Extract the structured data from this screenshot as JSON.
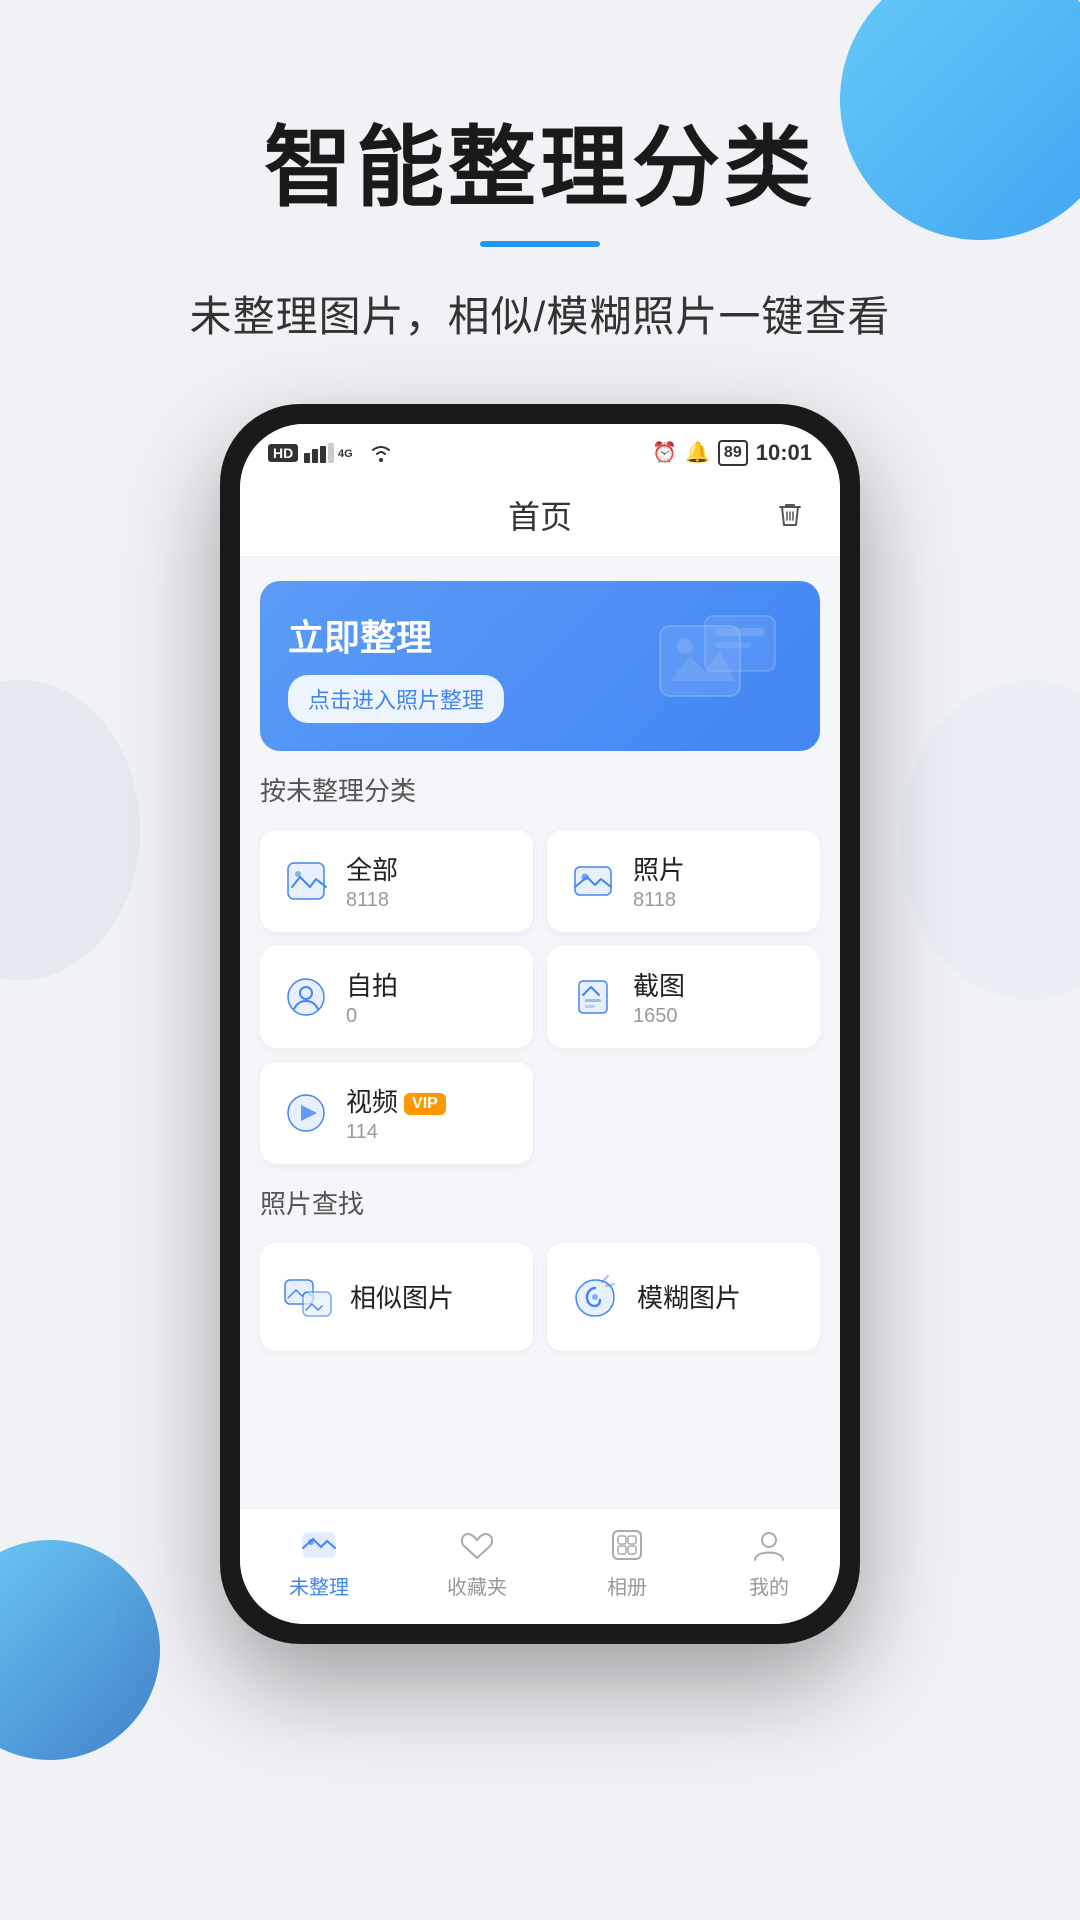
{
  "page": {
    "bg_color": "#f0f2f5",
    "main_title": "智能整理分类",
    "sub_title": "未整理图片，相似/模糊照片一键查看"
  },
  "status_bar": {
    "left": "HD 4G 4G WiFi",
    "alarm": "⏰",
    "battery": "89",
    "time": "10:01"
  },
  "app_header": {
    "title": "首页",
    "trash_label": "trash"
  },
  "banner": {
    "title": "立即整理",
    "button": "点击进入照片整理"
  },
  "section1_label": "按未整理分类",
  "categories": [
    {
      "name": "全部",
      "count": "8118",
      "icon": "all"
    },
    {
      "name": "照片",
      "count": "8118",
      "icon": "photo"
    },
    {
      "name": "自拍",
      "count": "0",
      "icon": "selfie"
    },
    {
      "name": "截图",
      "count": "1650",
      "icon": "screenshot"
    },
    {
      "name": "视频",
      "count": "114",
      "icon": "video",
      "vip": true
    }
  ],
  "section2_label": "照片查找",
  "find_items": [
    {
      "name": "相似图片",
      "icon": "similar"
    },
    {
      "name": "模糊图片",
      "icon": "blurry"
    }
  ],
  "bottom_nav": [
    {
      "label": "未整理",
      "icon": "unorganized",
      "active": true
    },
    {
      "label": "收藏夹",
      "icon": "favorites",
      "active": false
    },
    {
      "label": "相册",
      "icon": "album",
      "active": false
    },
    {
      "label": "我的",
      "icon": "mine",
      "active": false
    }
  ]
}
